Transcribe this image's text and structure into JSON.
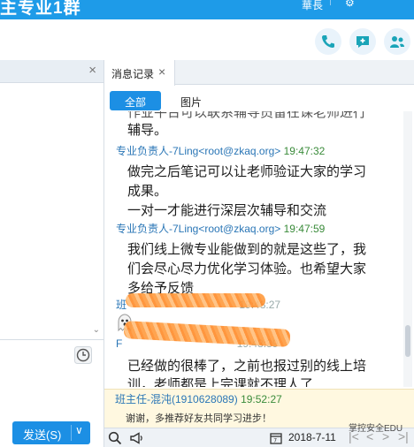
{
  "window": {
    "title": "主专业1群",
    "menu_label": "華長",
    "gear_glyph": "⚙"
  },
  "header": {
    "icons": [
      "phone-icon",
      "add-chat-icon",
      "more-icon"
    ]
  },
  "left_panel": {
    "close_glyph": "×",
    "send_label": "发送(S)",
    "send_caret": "∨",
    "scroll_glyph": "⌄"
  },
  "history": {
    "tab_label": "消息记录",
    "tab_close": "×",
    "filters": {
      "all": "全部",
      "images": "图片"
    },
    "messages": [
      {
        "cut_top": "作业平台可以联系辅导员留在课老师进行",
        "lines": [
          "辅导。"
        ]
      },
      {
        "sender": "专业负责人-7Ling<root@zkaq.org>",
        "time": "19:47:32",
        "lines": [
          "做完之后笔记可以让老师验证大家的学习",
          "成果。",
          "一对一才能进行深层次辅导和交流"
        ]
      },
      {
        "sender": "专业负责人-7Ling<root@zkaq.org>",
        "time": "19:47:59",
        "lines": [
          "我们线上微专业能做到的就是这些了，我",
          "们会尽心尽力优化学习体验。也希望大家",
          "多给予反馈"
        ]
      },
      {
        "sender_prefix": "班",
        "time": "19:48:27",
        "sticker": "ghost-icon"
      },
      {
        "sender_prefix": "F",
        "time": "19:48:39",
        "lines": [
          "已经做的很棒了，之前也报过别的线上培",
          "训，老师都是上完课就不理人了"
        ]
      }
    ],
    "notice": {
      "sender": "班主任-混沌(1910628089)",
      "time": "19:52:27",
      "text": "谢谢，多推荐好友共同学习进步！"
    },
    "bottom": {
      "date": "2018-7-11",
      "nav": [
        "|<",
        "<",
        ">",
        ">|"
      ]
    }
  },
  "watermark": "掌控安全EDU",
  "colors": {
    "accent": "#1c8fe4",
    "sender": "#2a76b6",
    "time": "#3a8b3a",
    "notice_bg": "#fff8e0"
  }
}
